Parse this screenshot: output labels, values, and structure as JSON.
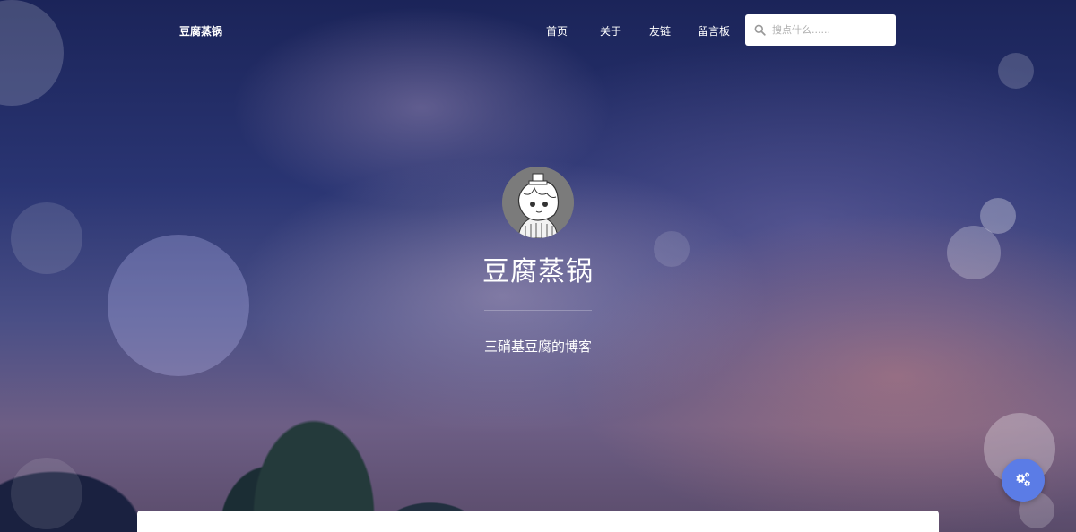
{
  "navbar": {
    "brand": "豆腐蒸锅",
    "links": [
      {
        "label": "首页"
      },
      {
        "label": "关于"
      },
      {
        "label": "友链"
      },
      {
        "label": "留言板"
      }
    ],
    "search": {
      "placeholder": "搜点什么......",
      "value": ""
    }
  },
  "hero": {
    "title": "豆腐蒸锅",
    "subtitle": "三硝基豆腐的博客",
    "avatar_icon": "anime-avatar"
  },
  "floating": {
    "settings_icon": "cogs-icon",
    "accent": "#5b7ce6"
  }
}
